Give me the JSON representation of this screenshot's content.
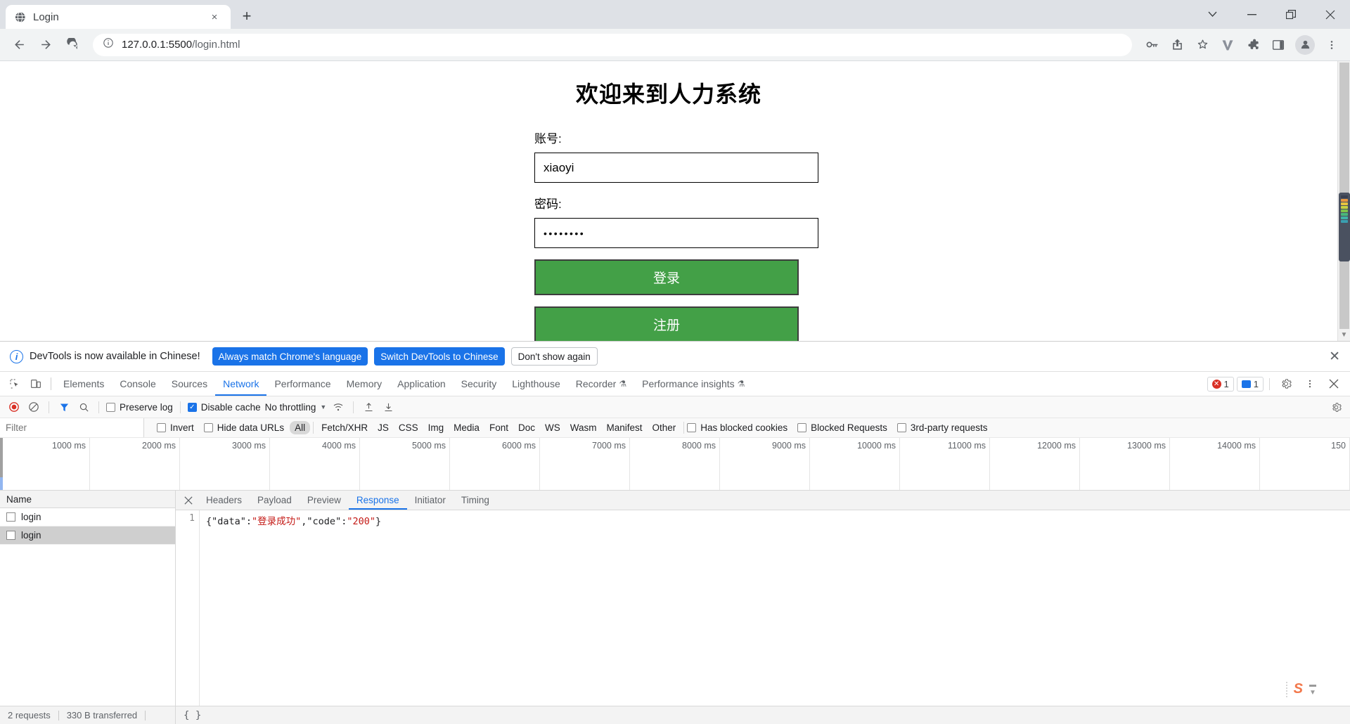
{
  "browser": {
    "tab": {
      "title": "Login",
      "favicon": "globe-icon",
      "close": "×"
    },
    "new_tab_label": "+",
    "window_controls": {
      "tab_search": "⌄",
      "minimize": "—",
      "restore": "❐",
      "close": "✕"
    },
    "toolbar": {
      "back": "←",
      "forward": "→",
      "reload": "↻",
      "site_info": "ⓘ",
      "url_host": "127.0.0.1:5500",
      "url_path": "/login.html",
      "icons": [
        "key-icon",
        "share-icon",
        "star-icon",
        "vimium-icon",
        "extensions-puzzle-icon",
        "side-panel-icon",
        "profile-avatar-icon",
        "chrome-menu-icon"
      ]
    }
  },
  "page": {
    "title": "欢迎来到人力系统",
    "account_label": "账号:",
    "account_value": "xiaoyi",
    "password_label": "密码:",
    "password_value": "••••••••",
    "login_button": "登录",
    "register_button": "注册",
    "button_color": "#43a047"
  },
  "devtools": {
    "banner": {
      "text": "DevTools is now available in Chinese!",
      "btn_always": "Always match Chrome's language",
      "btn_switch": "Switch DevTools to Chinese",
      "btn_dismiss": "Don't show again",
      "close": "✕",
      "accent": "#1a73e8"
    },
    "panels": [
      {
        "label": "Elements",
        "active": false
      },
      {
        "label": "Console",
        "active": false
      },
      {
        "label": "Sources",
        "active": false
      },
      {
        "label": "Network",
        "active": true
      },
      {
        "label": "Performance",
        "active": false
      },
      {
        "label": "Memory",
        "active": false
      },
      {
        "label": "Application",
        "active": false
      },
      {
        "label": "Security",
        "active": false
      },
      {
        "label": "Lighthouse",
        "active": false
      },
      {
        "label": "Recorder",
        "active": false,
        "beaker": "⚗"
      },
      {
        "label": "Performance insights",
        "active": false,
        "beaker": "⚗"
      }
    ],
    "panel_right": {
      "error_count": "1",
      "message_count": "1",
      "settings": "gear-icon",
      "more": "kebab-menu-icon",
      "close": "✕"
    },
    "network_toolbar": {
      "record": "record-button",
      "clear": "clear-button",
      "filter_icon": "filter-icon",
      "search_icon": "search-icon",
      "preserve_log": {
        "label": "Preserve log",
        "checked": false
      },
      "disable_cache": {
        "label": "Disable cache",
        "checked": true
      },
      "throttling": "No throttling",
      "wifi_icon": "network-conditions-icon",
      "import_icon": "import-har-icon",
      "export_icon": "export-har-icon",
      "settings_icon": "network-settings-icon"
    },
    "filter_row": {
      "placeholder": "Filter",
      "value": "",
      "invert": {
        "label": "Invert",
        "checked": false
      },
      "hide_data_urls": {
        "label": "Hide data URLs",
        "checked": false
      },
      "types": [
        {
          "label": "All",
          "active": true
        },
        {
          "label": "Fetch/XHR",
          "active": false
        },
        {
          "label": "JS",
          "active": false
        },
        {
          "label": "CSS",
          "active": false
        },
        {
          "label": "Img",
          "active": false
        },
        {
          "label": "Media",
          "active": false
        },
        {
          "label": "Font",
          "active": false
        },
        {
          "label": "Doc",
          "active": false
        },
        {
          "label": "WS",
          "active": false
        },
        {
          "label": "Wasm",
          "active": false
        },
        {
          "label": "Manifest",
          "active": false
        },
        {
          "label": "Other",
          "active": false
        }
      ],
      "has_blocked_cookies": {
        "label": "Has blocked cookies",
        "checked": false
      },
      "blocked_requests": {
        "label": "Blocked Requests",
        "checked": false
      },
      "third_party": {
        "label": "3rd-party requests",
        "checked": false
      }
    },
    "timeline_ticks": [
      "1000 ms",
      "2000 ms",
      "3000 ms",
      "4000 ms",
      "5000 ms",
      "6000 ms",
      "7000 ms",
      "8000 ms",
      "9000 ms",
      "10000 ms",
      "11000 ms",
      "12000 ms",
      "13000 ms",
      "14000 ms",
      "150"
    ],
    "requests": {
      "column_header": "Name",
      "rows": [
        {
          "name": "login",
          "selected": false
        },
        {
          "name": "login",
          "selected": true
        }
      ]
    },
    "detail_tabs": [
      {
        "label": "Headers",
        "active": false
      },
      {
        "label": "Payload",
        "active": false
      },
      {
        "label": "Preview",
        "active": false
      },
      {
        "label": "Response",
        "active": true
      },
      {
        "label": "Initiator",
        "active": false
      },
      {
        "label": "Timing",
        "active": false
      }
    ],
    "response": {
      "line_number": "1",
      "prefix": "{\"data\":",
      "value1": "\"登录成功\"",
      "middle": ",\"code\":",
      "value2": "\"200\"",
      "suffix": "}"
    },
    "status_bar": {
      "requests": "2 requests",
      "transferred": "330 B transferred",
      "format_button": "{ }"
    },
    "ime": {
      "logo": "S"
    }
  }
}
